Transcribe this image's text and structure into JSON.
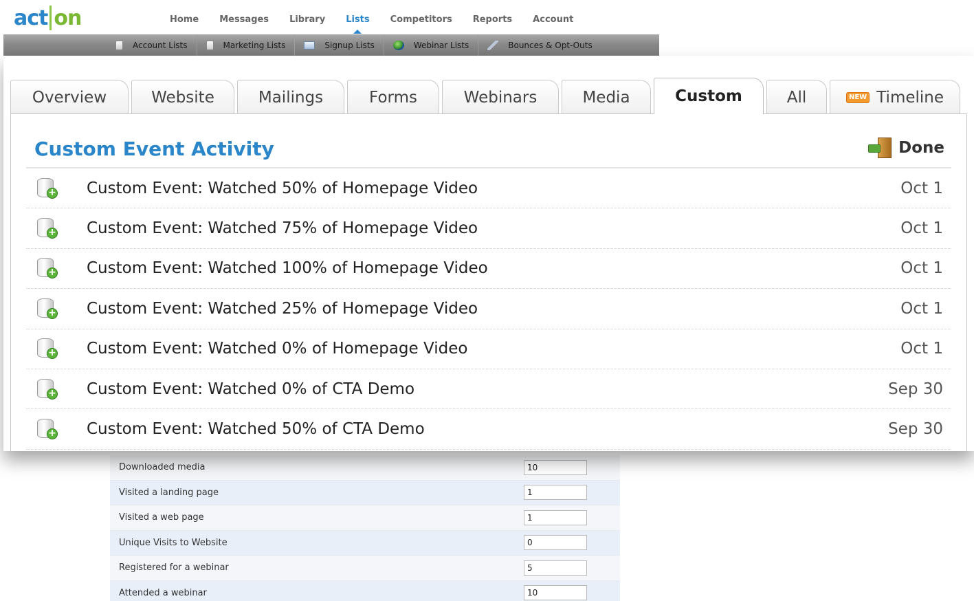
{
  "logo": {
    "part1": "act",
    "part2": "on"
  },
  "main_nav": [
    {
      "label": "Home",
      "active": false
    },
    {
      "label": "Messages",
      "active": false
    },
    {
      "label": "Library",
      "active": false
    },
    {
      "label": "Lists",
      "active": true
    },
    {
      "label": "Competitors",
      "active": false
    },
    {
      "label": "Reports",
      "active": false
    },
    {
      "label": "Account",
      "active": false
    }
  ],
  "sub_nav": [
    {
      "label": "Account Lists",
      "icon": "document-icon"
    },
    {
      "label": "Marketing Lists",
      "icon": "document-icon"
    },
    {
      "label": "Signup Lists",
      "icon": "card-icon"
    },
    {
      "label": "Webinar Lists",
      "icon": "globe-icon"
    },
    {
      "label": "Bounces & Opt-Outs",
      "icon": "wrench-icon"
    }
  ],
  "tabs": [
    {
      "label": "Overview",
      "active": false
    },
    {
      "label": "Website",
      "active": false
    },
    {
      "label": "Mailings",
      "active": false
    },
    {
      "label": "Forms",
      "active": false
    },
    {
      "label": "Webinars",
      "active": false
    },
    {
      "label": "Media",
      "active": false
    },
    {
      "label": "Custom",
      "active": true
    },
    {
      "label": "All",
      "active": false
    },
    {
      "label": "Timeline",
      "active": false,
      "badge": "NEW"
    }
  ],
  "panel": {
    "title": "Custom Event Activity",
    "done_label": "Done"
  },
  "events": [
    {
      "text": "Custom Event: Watched 50% of Homepage Video",
      "date": "Oct 1"
    },
    {
      "text": "Custom Event: Watched 75% of Homepage Video",
      "date": "Oct 1"
    },
    {
      "text": "Custom Event: Watched 100% of Homepage Video",
      "date": "Oct 1"
    },
    {
      "text": "Custom Event: Watched 25% of Homepage Video",
      "date": "Oct 1"
    },
    {
      "text": "Custom Event: Watched 0% of Homepage Video",
      "date": "Oct 1"
    },
    {
      "text": "Custom Event: Watched 0% of CTA Demo",
      "date": "Sep 30"
    },
    {
      "text": "Custom Event: Watched 50% of CTA Demo",
      "date": "Sep 30"
    }
  ],
  "form_rows": [
    {
      "label": "Downloaded media",
      "value": "10"
    },
    {
      "label": "Visited a landing page",
      "value": "1"
    },
    {
      "label": "Visited a web page",
      "value": "1"
    },
    {
      "label": "Unique Visits to Website",
      "value": "0"
    },
    {
      "label": "Registered for a webinar",
      "value": "5"
    },
    {
      "label": "Attended a webinar",
      "value": "10"
    }
  ],
  "colors": {
    "brand_blue": "#2a86c8",
    "brand_green": "#7ab833",
    "title_blue": "#2a86c8",
    "new_badge": "#f29a2e"
  }
}
